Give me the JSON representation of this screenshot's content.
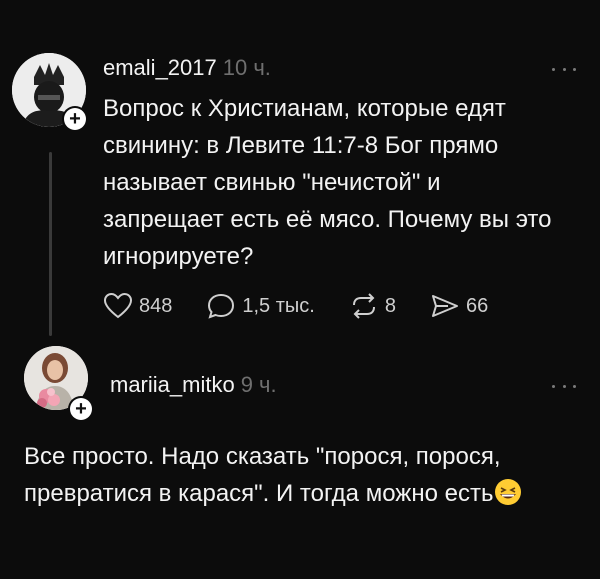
{
  "post1": {
    "username": "emali_2017",
    "time": "10 ч.",
    "text": "Вопрос к Христианам, которые едят\nсвинину: в Левите 11:7-8 Бог прямо\nназывает свинью \"нечистой\" и\nзапрещает есть её мясо. Почему вы это\nигнорируете?",
    "likes": "848",
    "comments": "1,5 тыс.",
    "reposts": "8",
    "shares": "66"
  },
  "post2": {
    "username": "mariia_mitko",
    "time": "9 ч.",
    "text": "Все просто. Надо сказать \"порося, порося,\nпревратися в карася\". И тогда можно есть"
  },
  "icons": {
    "plus": "+",
    "follow": "follow-plus-icon",
    "like": "heart-icon",
    "comment": "comment-bubble-icon",
    "repost": "repost-arrows-icon",
    "share": "send-icon",
    "emoji": "grinning-squinting-face-emoji"
  }
}
